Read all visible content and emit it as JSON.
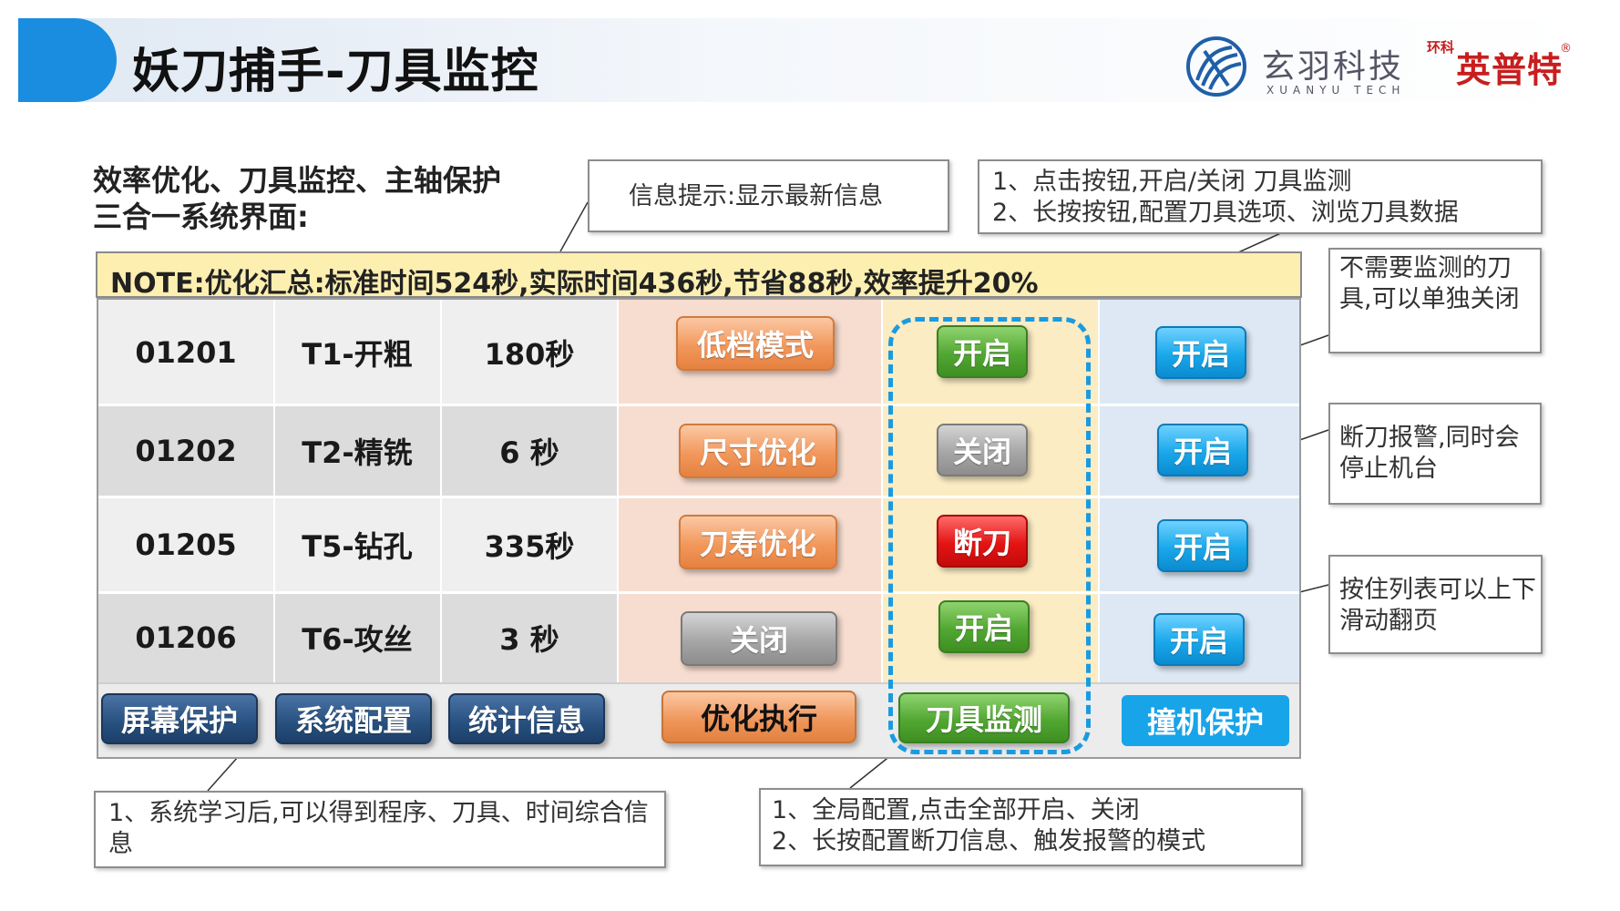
{
  "header": {
    "title": "妖刀捕手-刀具监控",
    "logo_cn": "玄羽科技",
    "logo_en": "XUANYU TECH",
    "partner_seal": "环科",
    "partner_brand": "英普特",
    "partner_reg": "®"
  },
  "subtitle": {
    "line1": "效率优化、刀具监控、主轴保护",
    "line2": "三合一系统界面:"
  },
  "callouts": {
    "info": "信息提示:显示最新信息",
    "toggle_1": "1、点击按钮,开启/关闭 刀具监测",
    "toggle_2": "2、长按按钮,配置刀具选项、浏览刀具数据",
    "no_monitor": "不需要监测的刀具,可以单独关闭",
    "break_alarm": "断刀报警,同时会停止机台",
    "scroll": "按住列表可以上下滑动翻页",
    "learn": "1、系统学习后,可以得到程序、刀具、时间综合信息",
    "global_1": "1、全局配置,点击全部开启、关闭",
    "global_2": "2、长按配置断刀信息、触发报警的模式"
  },
  "note": "NOTE:优化汇总:标准时间524秒,实际时间436秒,节省88秒,效率提升20%",
  "rows": [
    {
      "program": "01201",
      "tool": "T1-开粗",
      "time": "180秒",
      "optimize": "低档模式",
      "monitor": "开启",
      "crash": "开启"
    },
    {
      "program": "01202",
      "tool": "T2-精铣",
      "time": "6 秒",
      "optimize": "尺寸优化",
      "monitor": "关闭",
      "crash": "开启"
    },
    {
      "program": "01205",
      "tool": "T5-钻孔",
      "time": "335秒",
      "optimize": "刀寿优化",
      "monitor": "断刀",
      "crash": "开启"
    },
    {
      "program": "01206",
      "tool": "T6-攻丝",
      "time": "3 秒",
      "optimize": "关闭",
      "monitor": "开启",
      "crash": "开启"
    }
  ],
  "bottom_buttons": {
    "screen_protect": "屏幕保护",
    "system_config": "系统配置",
    "statistics": "统计信息",
    "optimize_exec": "优化执行",
    "tool_monitor": "刀具监测",
    "crash_protect": "撞机保护"
  },
  "colors": {
    "accent_blue": "#1a8de0",
    "note_bg": "#fcefb0",
    "brand_red": "#c81e1e"
  }
}
